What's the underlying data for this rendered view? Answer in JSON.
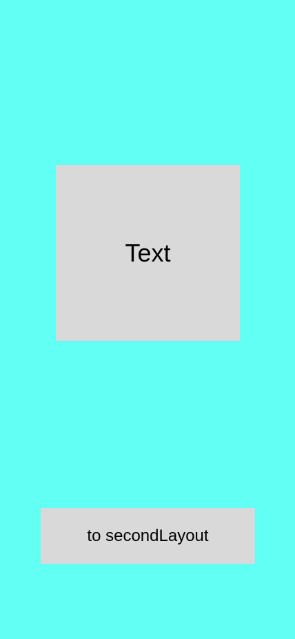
{
  "colors": {
    "background": "#62fff4",
    "panel": "#d9d9d9",
    "text": "#000000"
  },
  "main": {
    "text_box": {
      "label": "Text"
    },
    "nav_button": {
      "label": "to secondLayout"
    }
  }
}
